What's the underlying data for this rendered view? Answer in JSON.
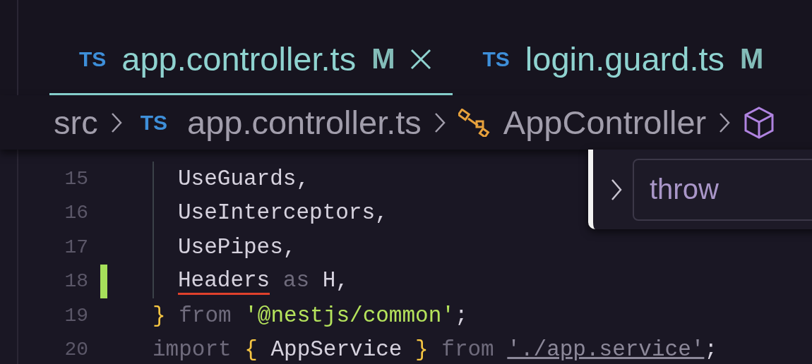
{
  "tabs": [
    {
      "lang": "TS",
      "label": "app.controller.ts",
      "badge": "M",
      "selected": true
    },
    {
      "lang": "TS",
      "label": "login.guard.ts",
      "badge": "M",
      "selected": false
    }
  ],
  "breadcrumbs": [
    {
      "kind": "folder",
      "text": "src"
    },
    {
      "kind": "file",
      "lang": "TS",
      "text": "app.controller.ts"
    },
    {
      "kind": "class",
      "text": "AppController"
    },
    {
      "kind": "method"
    }
  ],
  "code": {
    "lines": [
      {
        "number": "15",
        "modified": false,
        "indented": true,
        "tokens": [
          {
            "text": "UseGuards,",
            "kind": "plain",
            "error": false
          }
        ]
      },
      {
        "number": "16",
        "modified": false,
        "indented": true,
        "tokens": [
          {
            "text": "UseInterceptors,",
            "kind": "plain",
            "error": false
          }
        ]
      },
      {
        "number": "17",
        "modified": false,
        "indented": true,
        "tokens": [
          {
            "text": "UsePipes,",
            "kind": "plain",
            "error": false
          }
        ]
      },
      {
        "number": "18",
        "modified": true,
        "indented": true,
        "tokens": [
          {
            "text": "Headers",
            "kind": "plain",
            "error": true
          },
          {
            "text": " as ",
            "kind": "keyword",
            "error": false
          },
          {
            "text": "H,",
            "kind": "plain",
            "error": false
          }
        ]
      },
      {
        "number": "19",
        "modified": false,
        "indented": false,
        "tokens": [
          {
            "text": "}",
            "kind": "brace",
            "error": false
          },
          {
            "text": " from ",
            "kind": "keyword",
            "error": false
          },
          {
            "text": "'@nestjs/common'",
            "kind": "string",
            "error": false
          },
          {
            "text": ";",
            "kind": "plain",
            "error": false
          }
        ]
      },
      {
        "number": "20",
        "modified": false,
        "indented": false,
        "tokens": [
          {
            "text": "import ",
            "kind": "keyword",
            "error": false
          },
          {
            "text": "{",
            "kind": "brace",
            "error": false
          },
          {
            "text": " AppService ",
            "kind": "plain",
            "error": false
          },
          {
            "text": "}",
            "kind": "brace",
            "error": false
          },
          {
            "text": " from ",
            "kind": "keyword",
            "error": false
          },
          {
            "text": "'./app.service'",
            "kind": "path",
            "error": false
          },
          {
            "text": ";",
            "kind": "plain",
            "error": false
          }
        ]
      }
    ]
  },
  "find_widget": {
    "value": "throw",
    "expanded": false
  }
}
